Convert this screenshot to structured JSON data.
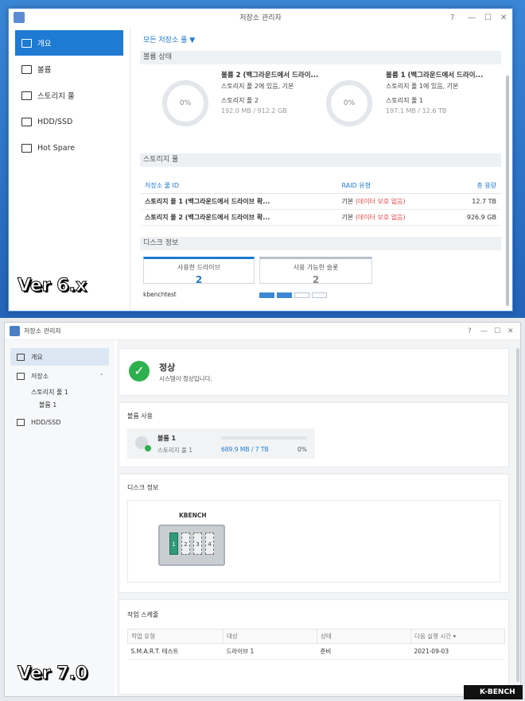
{
  "v6": {
    "title": "저장소 관리자",
    "controls": [
      "?",
      "—",
      "☐",
      "✕"
    ],
    "sidebar": [
      {
        "label": "개요",
        "icon": "overview-icon",
        "active": true
      },
      {
        "label": "볼륨",
        "icon": "volume-icon"
      },
      {
        "label": "스토리지 풀",
        "icon": "storage-pool-icon"
      },
      {
        "label": "HDD/SSD",
        "icon": "hdd-icon"
      },
      {
        "label": "Hot Spare",
        "icon": "hot-spare-icon"
      }
    ],
    "pool_dropdown": "모든 저장소 풀",
    "volume_status_header": "볼륨 상태",
    "volumes": [
      {
        "percent": "0%",
        "name": "볼륨 2 (백그라운드에서 드라이...",
        "line1": "스토리지 풀 2에 있음, 기본",
        "pool": "스토리지 풀 2",
        "size": "192.0 MB / 912.2 GB"
      },
      {
        "percent": "0%",
        "name": "볼륨 1 (백그라운드에서 드라이...",
        "line1": "스토리지 풀 1에 있음, 기본",
        "pool": "스토리지 풀 1",
        "size": "197.1 MB / 12.6 TB"
      }
    ],
    "storage_pool_header": "스토리지 풀",
    "pool_cols": [
      "저장소 풀 ID",
      "RAID 유형",
      "총 용량"
    ],
    "pools": [
      {
        "id": "스토리지 풀 1 (백그라운드에서 드라이브 확...",
        "raid": "기본",
        "note": "(데이터 보호 없음)",
        "cap": "12.7 TB"
      },
      {
        "id": "스토리지 풀 2 (백그라운드에서 드라이브 확...",
        "raid": "기본",
        "note": "(데이터 보호 없음)",
        "cap": "926.9 GB"
      }
    ],
    "disk_header": "디스크 정보",
    "used_drives_label": "사용한 드라이브",
    "used_drives": "2",
    "free_slots_label": "사용 가능한 슬롯",
    "free_slots": "2",
    "device": "kbenchtest",
    "slots_used": 2,
    "slots_total": 4,
    "version": "Ver 6.x"
  },
  "v7": {
    "title": "저장소 관리자",
    "controls": [
      "?",
      "—",
      "☐",
      "✕"
    ],
    "sidebar": [
      {
        "label": "개요",
        "active": true
      },
      {
        "label": "저장소"
      },
      {
        "label": "스토리지 풀 1"
      },
      {
        "label": "볼륨 1"
      },
      {
        "label": "HDD/SSD"
      }
    ],
    "status": "정상",
    "status_desc": "시스템이 정상입니다.",
    "volume_usage_header": "볼륨 사용",
    "volume_name": "볼륨 1",
    "volume_pool": "스토리지 풀 1",
    "volume_used": "689.9 MB / 7 TB",
    "volume_pct": "0%",
    "disk_header": "디스크 정보",
    "nas_brand": "KBENCH",
    "bays": [
      "1",
      "2",
      "3",
      "4"
    ],
    "job_header": "작업 스케줄",
    "job_cols": [
      "작업 유형",
      "대상",
      "상태",
      "다음 실행 시간 ▾"
    ],
    "jobs": [
      {
        "type": "S.M.A.R.T. 테스트",
        "target": "드라이브 1",
        "state": "준비",
        "next": "2021-09-03"
      }
    ],
    "version": "Ver 7.0",
    "logo": "K-BENCH"
  }
}
